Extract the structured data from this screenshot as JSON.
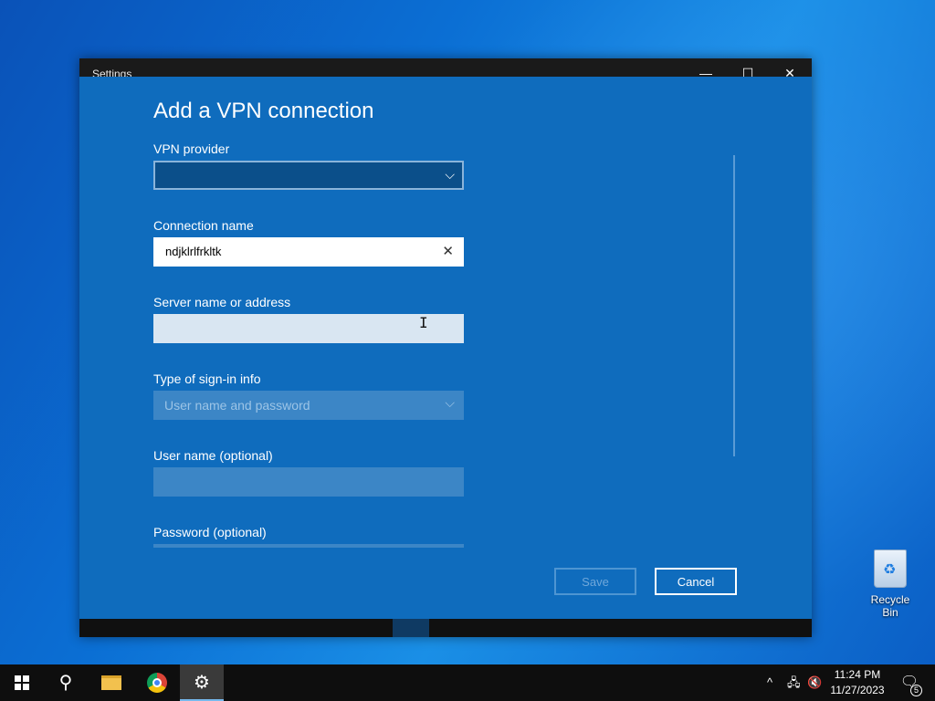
{
  "window": {
    "title": "Settings",
    "controls": {
      "minimize": "—",
      "maximize": "☐",
      "close": "✕"
    }
  },
  "page": {
    "heading": "Add a VPN connection"
  },
  "form": {
    "vpn_provider": {
      "label": "VPN provider",
      "value": ""
    },
    "connection_name": {
      "label": "Connection name",
      "value": "ndjklrlfrkltk"
    },
    "server": {
      "label": "Server name or address",
      "value": ""
    },
    "signin_type": {
      "label": "Type of sign-in info",
      "value": "User name and password"
    },
    "username": {
      "label": "User name (optional)",
      "value": ""
    },
    "password": {
      "label": "Password (optional)",
      "value": ""
    }
  },
  "buttons": {
    "save": "Save",
    "cancel": "Cancel"
  },
  "desktop": {
    "recycle_bin": "Recycle Bin"
  },
  "taskbar": {
    "time": "11:24 PM",
    "date": "11/27/2023",
    "notification_count": "5"
  },
  "icons": {
    "chevron_down": "⌵",
    "clear": "✕",
    "search": "⚲",
    "gear": "⚙",
    "chevron_up": "^",
    "network": "🖧",
    "volume_muted": "🔇",
    "notifications": "🗨",
    "ibeam": "I",
    "recycle": "♻"
  },
  "colors": {
    "content_bg": "#0f6cbd",
    "titlebar": "#1a1a1a",
    "taskbar": "#0e0e0e"
  }
}
